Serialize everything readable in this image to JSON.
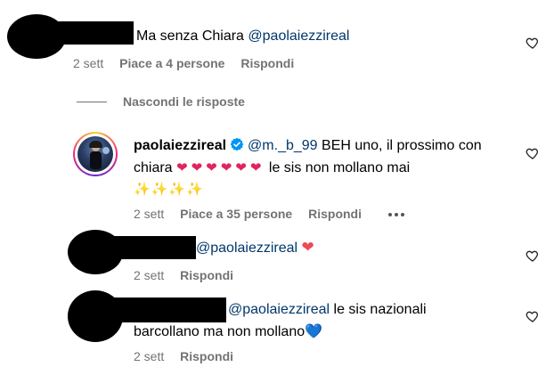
{
  "comments": [
    {
      "text": "Ma senza Chiara",
      "mention": "@paolaiezzireal",
      "meta": {
        "time": "2 sett",
        "likes": "Piace a 4 persone",
        "reply": "Rispondi"
      }
    }
  ],
  "replies_toggle": {
    "label": "Nascondi le risposte"
  },
  "replies": [
    {
      "username": "paolaiezzireal",
      "mention": "@m._b_99",
      "text_line1": "BEH uno, il prossimo con",
      "text_line2_start": "chiara",
      "text_line2_end": "le sis non mollano mai",
      "emoji_hearts": "❤❤❤❤❤❤",
      "emoji_sparkles": "✨✨✨✨",
      "meta": {
        "time": "2 sett",
        "likes": "Piace a 35 persone",
        "reply": "Rispondi"
      }
    },
    {
      "mention": "@paolaiezzireal",
      "emoji": "❤",
      "meta": {
        "time": "2 sett",
        "reply": "Rispondi"
      }
    },
    {
      "mention": "@paolaiezzireal",
      "text_line1": "le sis nazionali",
      "text_line2": "barcollano ma non mollano",
      "emoji": "💙",
      "meta": {
        "time": "2 sett",
        "reply": "Rispondi"
      }
    }
  ],
  "icons": {
    "like": "heart-outline-icon",
    "verified": "verified-badge-icon",
    "more": "more-options-icon"
  },
  "colors": {
    "mention": "#00376b",
    "meta": "#737373",
    "verified": "#0095f6",
    "heart_red": "#ed4956",
    "blue_heart": "#5bc8f5"
  }
}
